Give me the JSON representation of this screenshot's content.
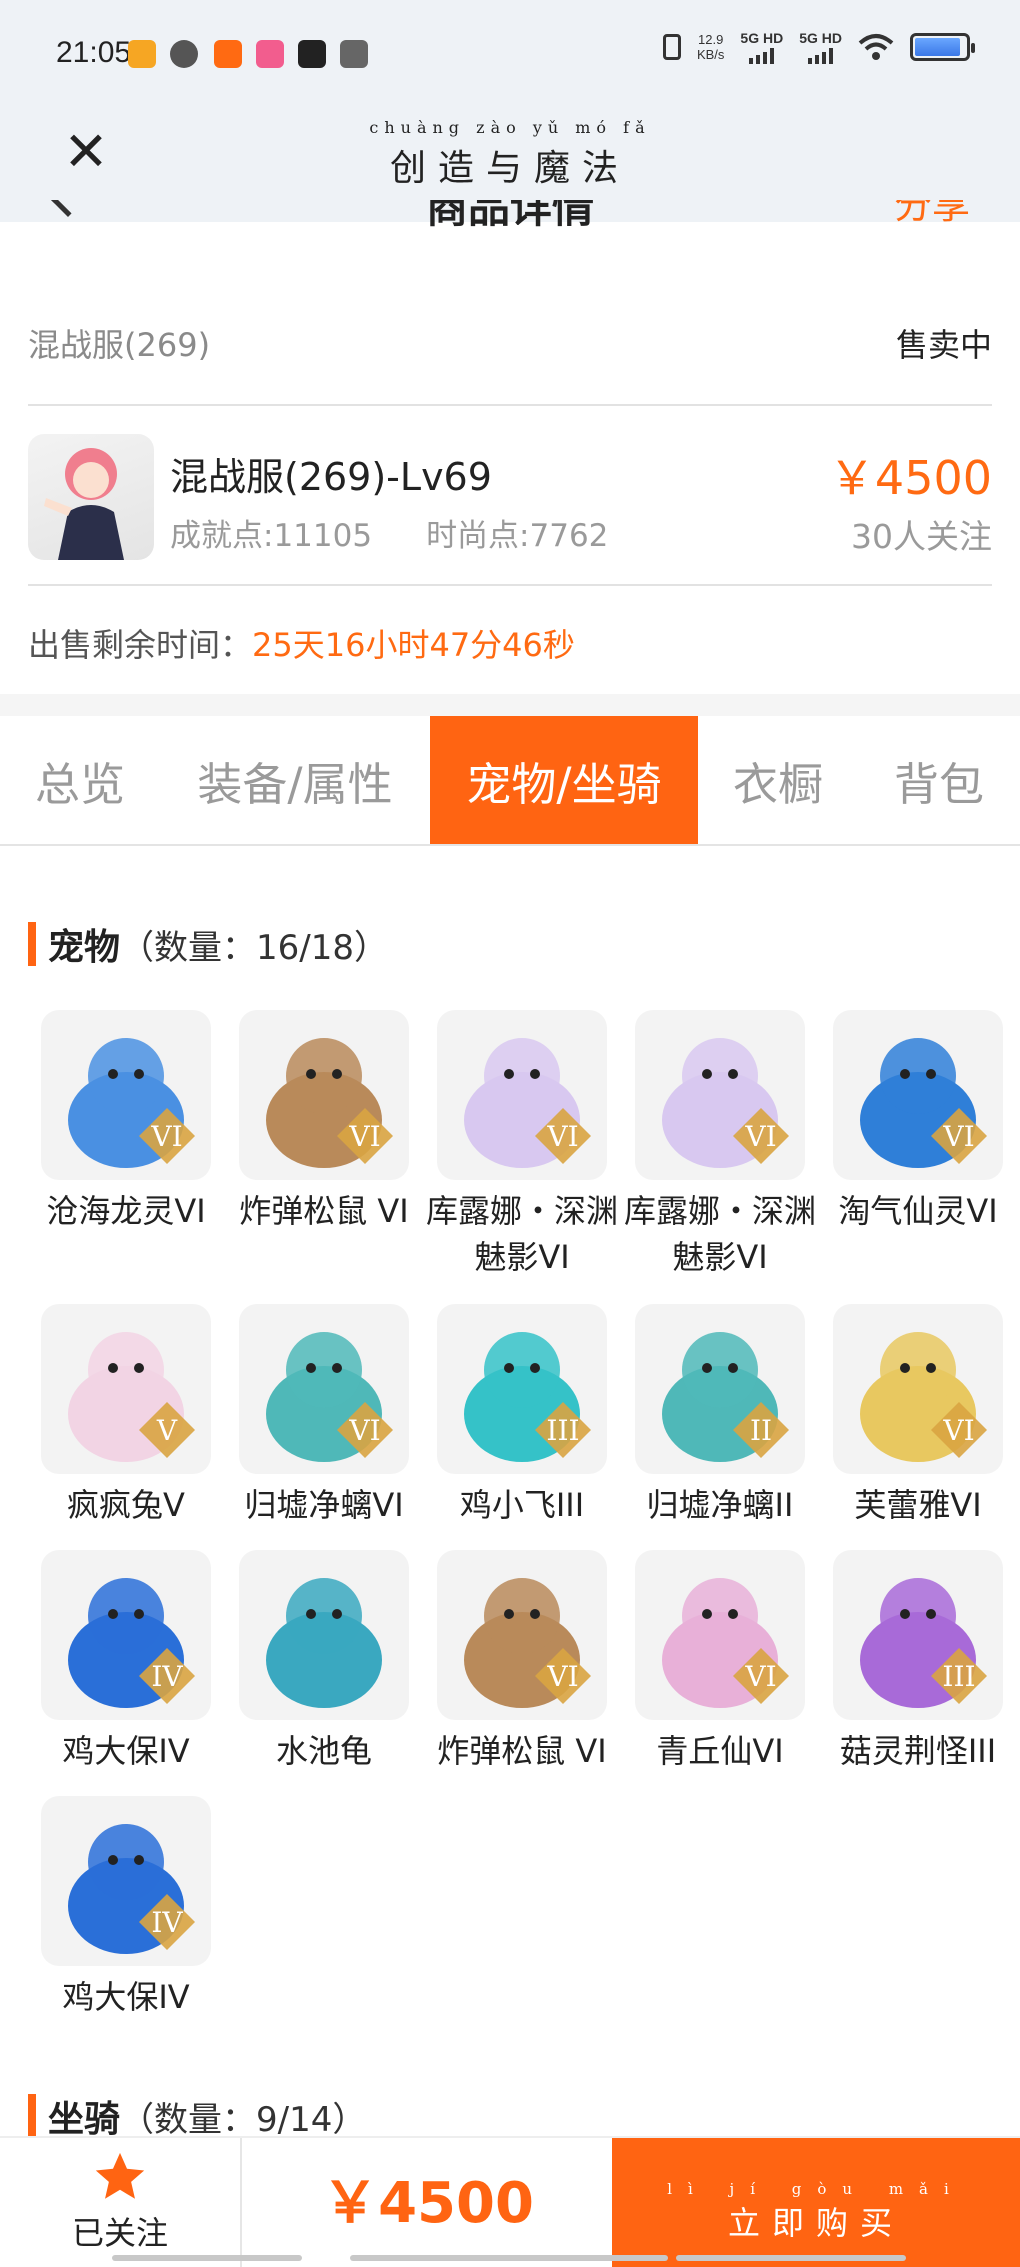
{
  "status_bar": {
    "time": "21:05",
    "net_speed_value": "12.9",
    "net_speed_unit": "KB/s",
    "sim1": "5G HD",
    "sim2": "5G HD",
    "battery_level": 0.9
  },
  "header": {
    "close_icon": "close-icon",
    "title_pinyin": "chuàng zào yǔ mó fǎ",
    "title": "创造与魔法"
  },
  "page_heading": {
    "title": "商品详情",
    "share_label": "分享"
  },
  "account": {
    "server": "混战服(269)",
    "sale_status": "售卖中",
    "name": "混战服(269)-Lv69",
    "achievement": "成就点:11105",
    "fashion": "时尚点:7762",
    "price": "￥4500",
    "followers": "30人关注",
    "remaining_label": "出售剩余时间：",
    "remaining_value": "25天16小时47分46秒"
  },
  "tabs": [
    {
      "label": "总览",
      "active": false
    },
    {
      "label": "装备/属性",
      "active": false
    },
    {
      "label": "宠物/坐骑",
      "active": true
    },
    {
      "label": "衣橱",
      "active": false
    },
    {
      "label": "背包",
      "active": false
    }
  ],
  "pets_section": {
    "title": "宠物",
    "count": "（数量：16/18）",
    "items": [
      {
        "name": "沧海龙灵VI",
        "badge": "VI",
        "color": "#4a90e2"
      },
      {
        "name": "炸弹松鼠 VI",
        "badge": "VI",
        "color": "#b98a5a"
      },
      {
        "name": "库露娜・深渊魅影VI",
        "badge": "VI",
        "color": "#d8c8f0"
      },
      {
        "name": "库露娜・深渊魅影VI",
        "badge": "VI",
        "color": "#d8c8f0"
      },
      {
        "name": "淘气仙灵VI",
        "badge": "VI",
        "color": "#2f7fd8"
      },
      {
        "name": "疯疯兔V",
        "badge": "V",
        "color": "#f2d4e4"
      },
      {
        "name": "归墟净螭VI",
        "badge": "VI",
        "color": "#4fb8b8"
      },
      {
        "name": "鸡小飞III",
        "badge": "III",
        "color": "#35c2c8"
      },
      {
        "name": "归墟净螭II",
        "badge": "II",
        "color": "#4fb8b8"
      },
      {
        "name": "芙蕾雅VI",
        "badge": "VI",
        "color": "#e8c860"
      },
      {
        "name": "鸡大保IV",
        "badge": "IV",
        "color": "#2a6fd8"
      },
      {
        "name": "水池龟",
        "badge": "",
        "color": "#3aa8c0"
      },
      {
        "name": "炸弹松鼠 VI",
        "badge": "VI",
        "color": "#b98a5a"
      },
      {
        "name": "青丘仙VI",
        "badge": "VI",
        "color": "#e8b0d8"
      },
      {
        "name": "菇灵荆怪III",
        "badge": "III",
        "color": "#a86ad8"
      },
      {
        "name": "鸡大保IV",
        "badge": "IV",
        "color": "#2a6fd8"
      }
    ]
  },
  "mounts_section": {
    "title": "坐骑",
    "count": "（数量：9/14）"
  },
  "bottom_bar": {
    "follow_icon": "star-icon",
    "follow_label": "已关注",
    "price": "￥4500",
    "buy_pinyin": "lì jí gòu mǎi",
    "buy_label": "立即购买"
  },
  "colors": {
    "accent": "#ff6412",
    "header_bg": "#eef2f6"
  }
}
